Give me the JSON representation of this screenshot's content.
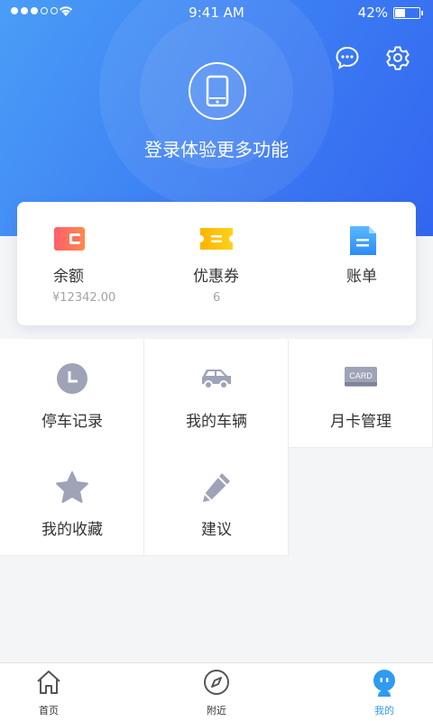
{
  "status_bar": {
    "time": "9:41 AM",
    "battery_percent": "42%",
    "battery_level": 0.42
  },
  "header": {
    "login_prompt": "登录体验更多功能",
    "icons": [
      "chat-icon",
      "gear-icon",
      "phone-icon"
    ]
  },
  "summary": {
    "items": [
      {
        "label": "余额",
        "value": "¥12342.00",
        "icon": "wallet-icon"
      },
      {
        "label": "优惠券",
        "value": "6",
        "icon": "coupon-icon"
      },
      {
        "label": "账单",
        "value": "",
        "icon": "bill-icon"
      }
    ]
  },
  "features": {
    "items": [
      {
        "label": "停车记录",
        "icon": "clock-icon"
      },
      {
        "label": "我的车辆",
        "icon": "car-icon"
      },
      {
        "label": "月卡管理",
        "icon": "card-icon",
        "badge_text": "CARD"
      },
      {
        "label": "我的收藏",
        "icon": "star-icon"
      },
      {
        "label": "建议",
        "icon": "pencil-icon"
      }
    ]
  },
  "tabbar": {
    "tabs": [
      {
        "label": "首页",
        "icon": "home-icon"
      },
      {
        "label": "附近",
        "icon": "compass-icon"
      },
      {
        "label": "我的",
        "icon": "profile-icon",
        "active": true
      }
    ]
  },
  "colors": {
    "accent": "#2f9bf0",
    "header_start": "#4a9df7",
    "header_end": "#3366f0",
    "icon_gray": "#9ea3b8"
  }
}
